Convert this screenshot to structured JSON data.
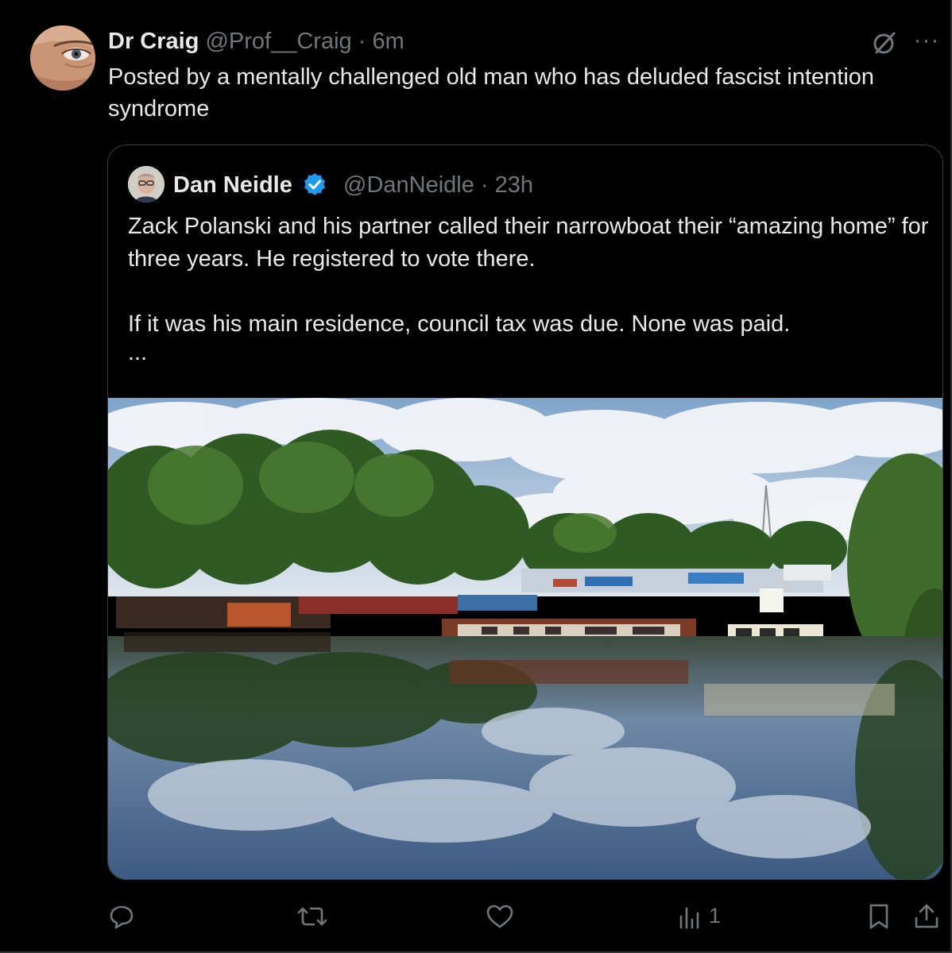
{
  "post": {
    "author_name": "Dr Craig",
    "handle": "@Prof__Craig",
    "separator": "·",
    "time": "6m",
    "more_label": "···",
    "text": "Posted by a mentally challenged old man who has deluded fascist intention syndrome"
  },
  "quoted_post": {
    "author_name": "Dan Neidle",
    "verified": true,
    "handle": "@DanNeidle",
    "separator": "·",
    "time": "23h",
    "paragraph_1": "Zack Polanski and his partner called their narrowboat their “amazing home” for three years. He registered to vote there.",
    "paragraph_2": "If it was his main residence, council tax was due. None was paid.",
    "truncation": "...",
    "media": {
      "type": "photo",
      "description_icon": "narrowboats-marina-photo"
    }
  },
  "actions": {
    "reply_icon": "reply-icon",
    "repost_icon": "repost-icon",
    "like_icon": "like-icon",
    "views_icon": "views-icon",
    "views_count": "1",
    "bookmark_icon": "bookmark-icon",
    "share_icon": "share-icon"
  },
  "colors": {
    "background": "#000000",
    "text": "#e7e9ea",
    "muted": "#71767b",
    "verified": "#1d9bf0",
    "border": "#2f3336"
  }
}
